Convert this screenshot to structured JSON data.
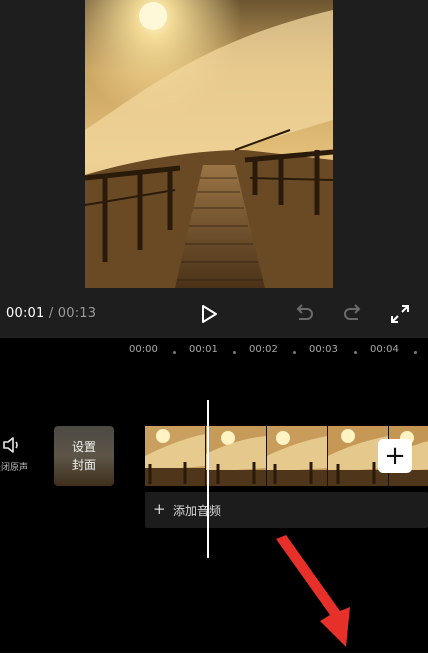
{
  "player": {
    "current_time": "00:01",
    "separator": "/",
    "total_time": "00:13",
    "play_icon": "play-icon",
    "undo_icon": "undo-icon",
    "redo_icon": "redo-icon",
    "fullscreen_icon": "fullscreen-icon"
  },
  "ruler": {
    "marks": [
      "00:00",
      "00:01",
      "00:02",
      "00:03",
      "00:04"
    ]
  },
  "tracks": {
    "audio_toggle_label": "关闭原声",
    "cover_label_line1": "设置",
    "cover_label_line2": "封面",
    "add_clip_symbol": "+",
    "add_audio_symbol": "+",
    "add_audio_label": "添加音频"
  },
  "colors": {
    "panel_bg": "#1e1e1e",
    "timeline_bg": "#000000",
    "annotation_arrow": "#e8302a"
  }
}
